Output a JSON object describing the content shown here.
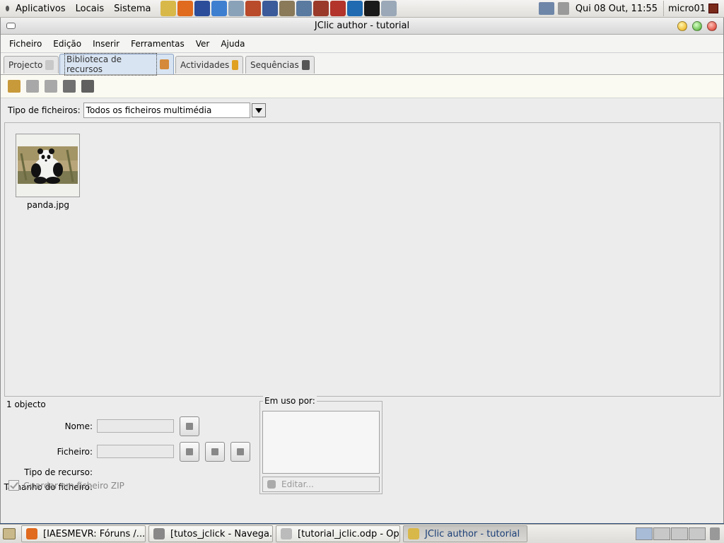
{
  "top_panel": {
    "menus": [
      "Aplicativos",
      "Locais",
      "Sistema"
    ],
    "launchers": [
      {
        "icon": "jclic-icon",
        "color": "#d9b84a"
      },
      {
        "icon": "firefox-icon",
        "color": "#e06a1e"
      },
      {
        "icon": "thunderbird-icon",
        "color": "#2c4d9a"
      },
      {
        "icon": "ie-icon",
        "color": "#3f7fd0"
      },
      {
        "icon": "screenshot-icon",
        "color": "#8aa2b8"
      },
      {
        "icon": "tool-icon",
        "color": "#b94a2a"
      },
      {
        "icon": "paint-icon",
        "color": "#3a5a9a"
      },
      {
        "icon": "gimp-icon",
        "color": "#8a7a5a"
      },
      {
        "icon": "pen-icon",
        "color": "#5a7aa0"
      },
      {
        "icon": "calc-icon",
        "color": "#9a3a2a"
      },
      {
        "icon": "impress-icon",
        "color": "#b2342a"
      },
      {
        "icon": "browser-icon",
        "color": "#1f6ab0"
      },
      {
        "icon": "terminal-icon",
        "color": "#1a1a1a"
      },
      {
        "icon": "editor-icon",
        "color": "#9aa8b8"
      }
    ],
    "clock": "Qui 08 Out, 11:55",
    "user": "micro01"
  },
  "window": {
    "title": "JClic author - tutorial",
    "menu": [
      "Ficheiro",
      "Edição",
      "Inserir",
      "Ferramentas",
      "Ver",
      "Ajuda"
    ],
    "tabs": [
      {
        "label": "Projecto",
        "icon": "project-icon",
        "color": "#c8c8c8"
      },
      {
        "label": "Biblioteca de recursos",
        "icon": "library-icon",
        "color": "#d48a3a"
      },
      {
        "label": "Actividades",
        "icon": "activities-icon",
        "color": "#e0a020"
      },
      {
        "label": "Sequências",
        "icon": "sequences-icon",
        "color": "#555555"
      }
    ],
    "toolbar_icons": [
      "add-resource-icon",
      "view-resource-icon",
      "delete-icon",
      "update-icon",
      "copy-icon"
    ],
    "filter": {
      "label": "Tipo de ficheiros:",
      "value": "Todos os ficheiros multimédia"
    },
    "resources": [
      {
        "name": "panda.jpg"
      }
    ],
    "status": "1 objecto",
    "properties": {
      "name_label": "Nome:",
      "file_label": "Ficheiro:",
      "type_label": "Tipo de recurso:",
      "size_label": "Tamanho do ficheiro:",
      "zip_label": "Guardar em ficheiro ZIP",
      "usage_legend": "Em uso por:",
      "edit_label": "Editar..."
    }
  },
  "taskbar": {
    "tasks": [
      {
        "label": "[IAESMEVR: Fóruns /...",
        "icon": "firefox-icon",
        "color": "#e06a1e"
      },
      {
        "label": "[tutos_jclick - Navega...",
        "icon": "file-manager-icon",
        "color": "#888888"
      },
      {
        "label": "[tutorial_jclic.odp - Op...",
        "icon": "document-icon",
        "color": "#bbbbbb"
      },
      {
        "label": "JClic author - tutorial",
        "icon": "jclic-icon",
        "color": "#d9b84a"
      }
    ]
  }
}
